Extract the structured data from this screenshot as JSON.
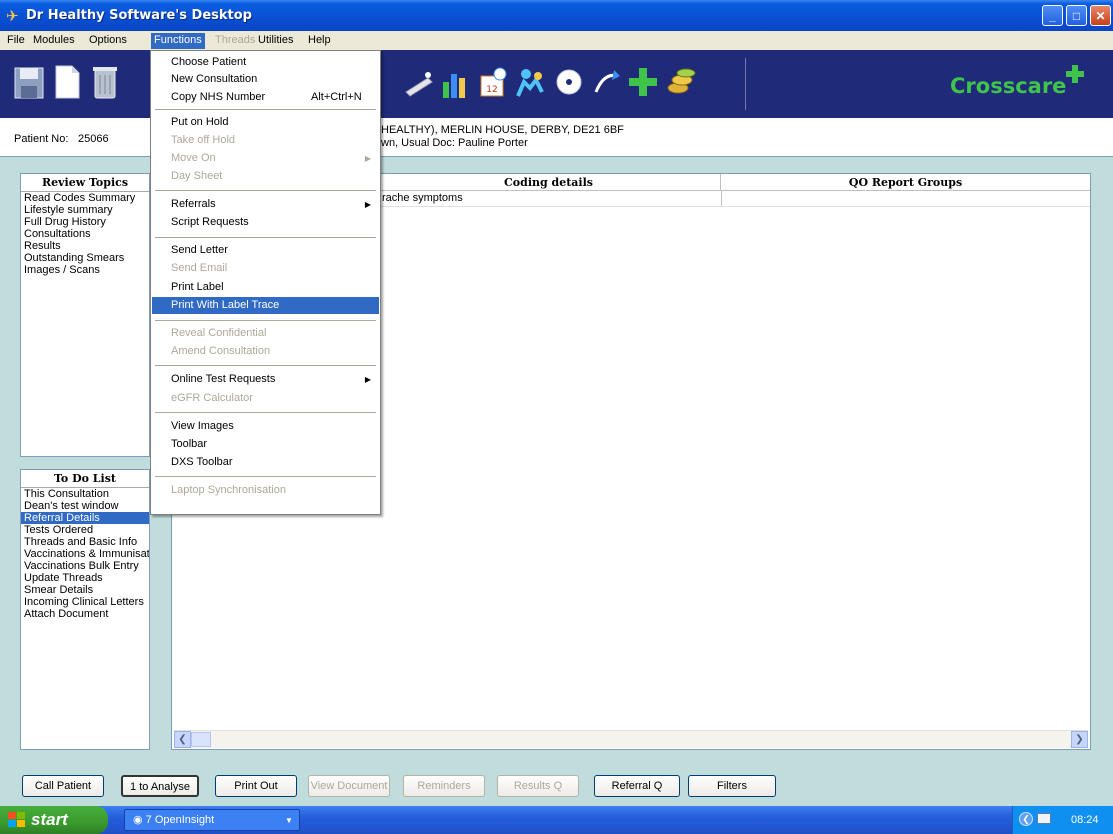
{
  "window": {
    "title": "Dr Healthy Software's Desktop"
  },
  "menubar": {
    "items": [
      "File",
      "Modules",
      "Options",
      "Functions",
      "Threads",
      "Utilities",
      "Help"
    ]
  },
  "toolbar": {
    "brand": "Crosscare"
  },
  "patient": {
    "label": "Patient No:",
    "number": "25066",
    "address_line": "HEALTHY), MERLIN HOUSE, DERBY, DE21 6BF",
    "doctor_line": "wn, Usual Doc: Pauline Porter"
  },
  "review_topics": {
    "header": "Review Topics",
    "items": [
      "Read Codes Summary",
      "Lifestyle summary",
      "Full Drug History",
      "Consultations",
      "Results",
      "Outstanding Smears",
      "Images / Scans"
    ]
  },
  "todo": {
    "header": "To Do List",
    "items": [
      "This Consultation",
      "Dean's test window",
      "Referral Details",
      "Tests Ordered",
      "Threads and Basic Info",
      "Vaccinations & Immunisations",
      "Vaccinations Bulk Entry",
      "Update Threads",
      "Smear Details",
      "Incoming Clinical Letters",
      "Attach Document"
    ],
    "selected_index": 2
  },
  "grid": {
    "columns": [
      "Coding details",
      "QO Report Groups"
    ],
    "rows": [
      [
        "rache symptoms",
        ""
      ]
    ]
  },
  "functions_menu": {
    "items": [
      {
        "label": "Choose Patient"
      },
      {
        "label": "New Consultation"
      },
      {
        "label": "Copy NHS Number",
        "shortcut": "Alt+Ctrl+N"
      },
      {
        "label": "Put on Hold"
      },
      {
        "label": "Take off Hold",
        "disabled": true
      },
      {
        "label": "Move On",
        "disabled": true,
        "submenu": true
      },
      {
        "label": "Day Sheet",
        "disabled": true
      },
      {
        "label": "Referrals",
        "submenu": true
      },
      {
        "label": "Script Requests"
      },
      {
        "label": "Send Letter"
      },
      {
        "label": "Send Email",
        "disabled": true
      },
      {
        "label": "Print Label"
      },
      {
        "label": "Print With Label Trace",
        "highlighted": true
      },
      {
        "label": "Reveal Confidential",
        "disabled": true
      },
      {
        "label": "Amend Consultation",
        "disabled": true
      },
      {
        "label": "Online Test Requests",
        "submenu": true
      },
      {
        "label": "eGFR Calculator",
        "disabled": true
      },
      {
        "label": "View Images"
      },
      {
        "label": "Toolbar"
      },
      {
        "label": "DXS Toolbar"
      },
      {
        "label": "Laptop Synchronisation",
        "disabled": true
      }
    ]
  },
  "bottom_buttons": [
    {
      "label": "Call Patient"
    },
    {
      "label": "1 to Analyse"
    },
    {
      "label": "Print Out"
    },
    {
      "label": "View Document",
      "disabled": true
    },
    {
      "label": "Reminders",
      "disabled": true
    },
    {
      "label": "Results Q",
      "disabled": true
    },
    {
      "label": "Referral Q"
    },
    {
      "label": "Filters"
    }
  ],
  "taskbar": {
    "start_label": "start",
    "task_label": "7 OpenInsight",
    "clock": "08:24"
  },
  "colors": {
    "toolbar_bg": "#1f2a79",
    "brand_green": "#3fc34a",
    "highlight": "#316ac5"
  }
}
